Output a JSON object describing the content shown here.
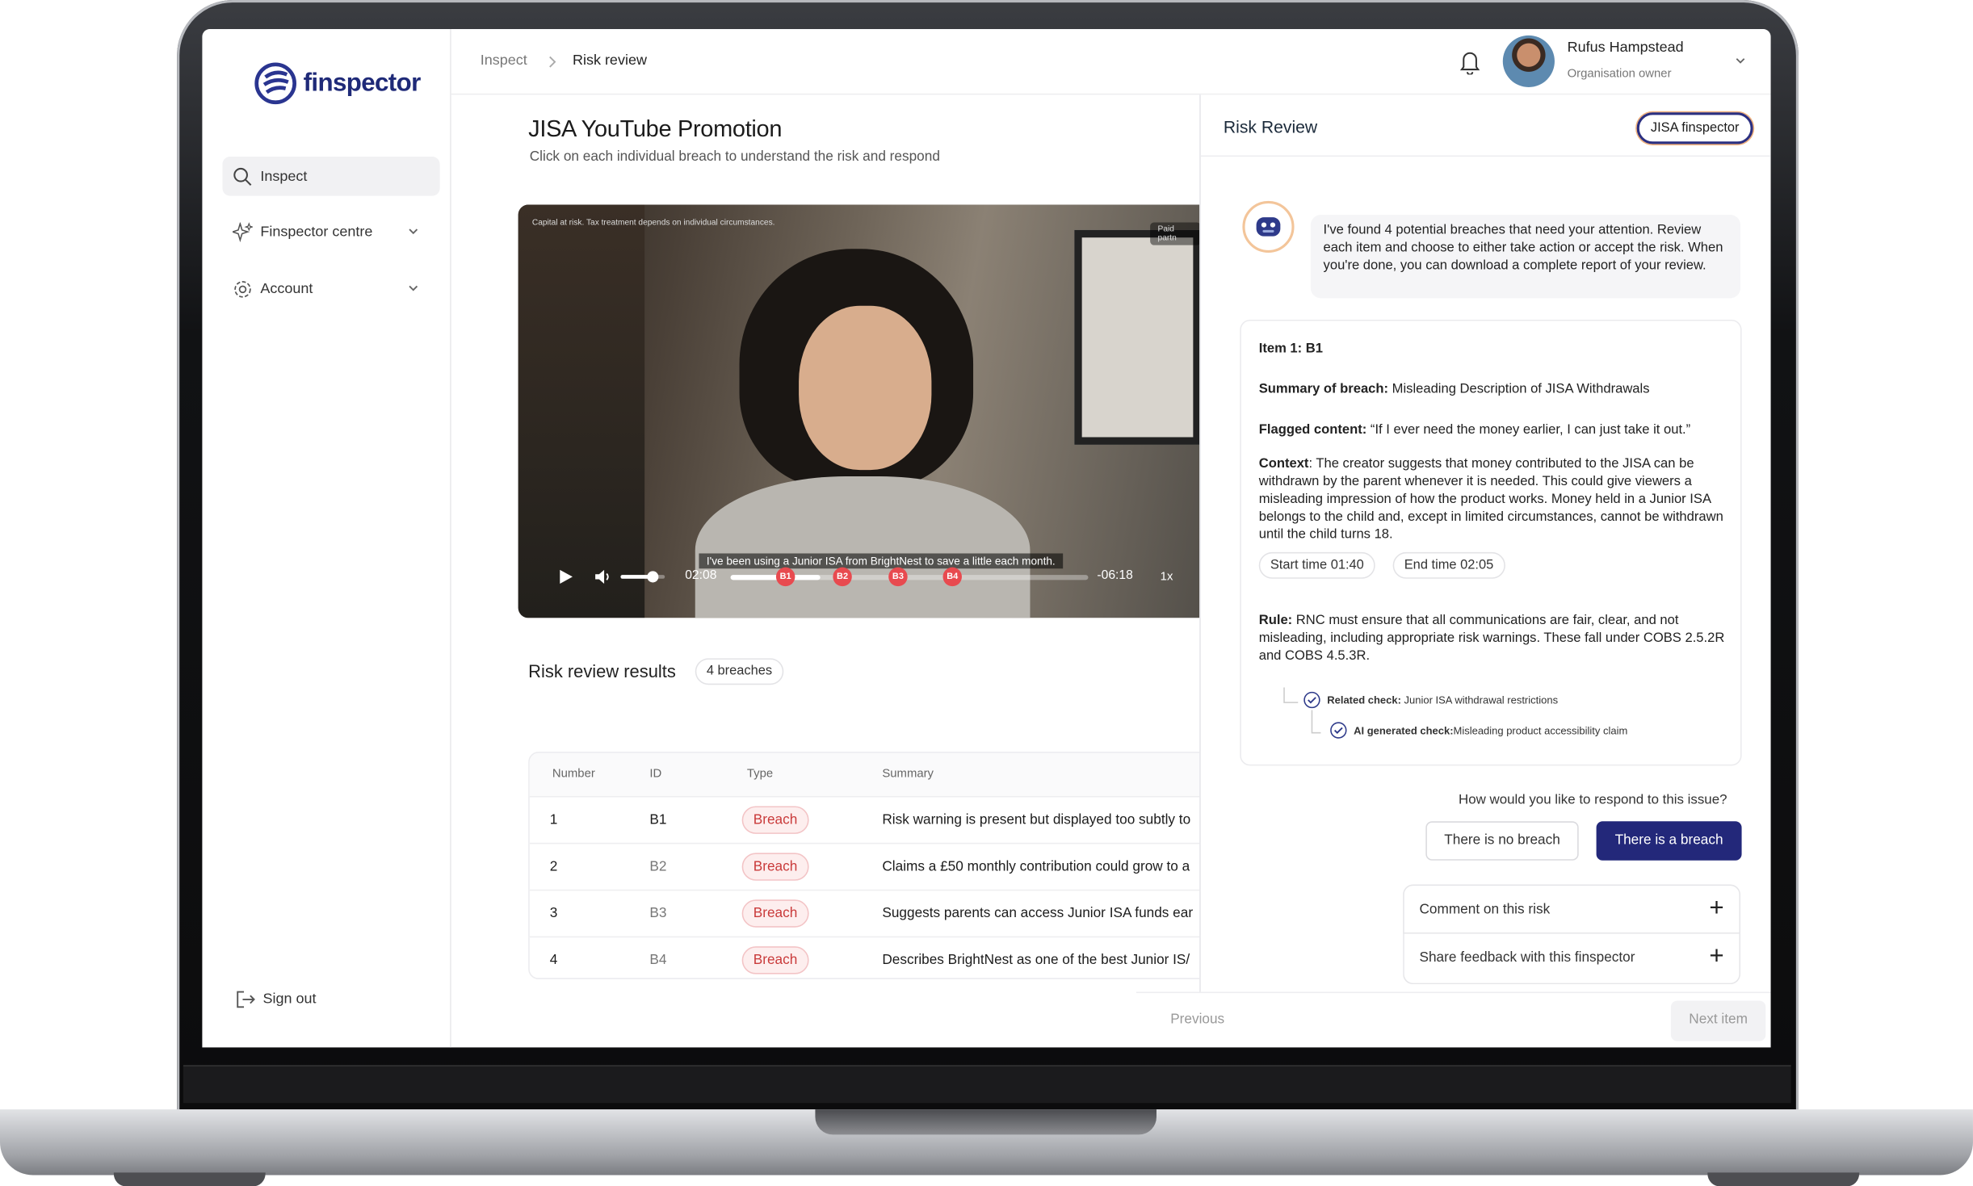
{
  "app": {
    "brand": "finspector"
  },
  "sidebar": {
    "items": [
      {
        "label": "Inspect"
      },
      {
        "label": "Finspector centre"
      },
      {
        "label": "Account"
      }
    ],
    "signout": "Sign out"
  },
  "breadcrumb": {
    "root": "Inspect",
    "current": "Risk review"
  },
  "user": {
    "name": "Rufus Hampstead",
    "role": "Organisation owner"
  },
  "main": {
    "title": "JISA YouTube Promotion",
    "subtitle": "Click on each individual breach to understand the risk and respond"
  },
  "video": {
    "disclaimer": "Capital at risk. Tax treatment depends on individual circumstances.",
    "tag": "Paid partn",
    "caption": "I've been using a Junior ISA from BrightNest to save a little each month.",
    "current_time": "02:08",
    "remaining": "-06:18",
    "speed": "1x",
    "progress": 0.25,
    "volume": 0.7,
    "markers": [
      "B1",
      "B2",
      "B3",
      "B4"
    ]
  },
  "results": {
    "title": "Risk review results",
    "count": "4 breaches",
    "columns": [
      "Number",
      "ID",
      "Type",
      "Summary"
    ],
    "rows": [
      {
        "number": "1",
        "id": "B1",
        "type": "Breach",
        "summary": "Risk warning is present but displayed too subtly to"
      },
      {
        "number": "2",
        "id": "B2",
        "type": "Breach",
        "summary": "Claims a £50 monthly contribution could grow to a"
      },
      {
        "number": "3",
        "id": "B3",
        "type": "Breach",
        "summary": "Suggests parents can access Junior ISA funds ear"
      },
      {
        "number": "4",
        "id": "B4",
        "type": "Breach",
        "summary": "Describes BrightNest as one of the best Junior IS/"
      }
    ]
  },
  "panel": {
    "title": "Risk Review",
    "tag": "JISA finspector",
    "bot_message": "I've found 4 potential breaches that need your attention. Review each item and choose to either take action or accept the risk. When you're done, you can download a complete report of your review.",
    "item": "Item 1: B1",
    "summary_label": "Summary of breach:",
    "summary": "Misleading Description of JISA Withdrawals",
    "flagged_label": "Flagged content:",
    "flagged": "“If I ever need the money earlier, I can just take it out.”",
    "context_label": "Context",
    "context": ": The creator suggests that money contributed to the JISA can be withdrawn by the parent whenever it is needed. This could give viewers a misleading impression of how the product works. Money held in a Junior ISA belongs to the child and, except in limited circumstances, cannot be withdrawn until the child turns 18.",
    "start": "Start time 01:40",
    "end": "End time 02:05",
    "rule_label": "Rule:",
    "rule": "RNC must ensure that all communications are fair, clear, and not misleading, including appropriate risk warnings. These fall under COBS 2.5.2R and COBS 4.5.3R.",
    "related_label": "Related check:",
    "related": "Junior ISA withdrawal restrictions",
    "ai_label": "AI generated check:",
    "ai": "Misleading product accessibility claim",
    "question": "How would you like to respond to this issue?",
    "no_breach": "There is no breach",
    "breach": "There is a breach",
    "comment": "Comment on this risk",
    "feedback": "Share feedback with this finspector",
    "previous": "Previous",
    "next": "Next item"
  },
  "colors": {
    "brand": "#1f2a78",
    "primary_button": "#23287a",
    "breach": "#c93a3a",
    "marker": "#e84a4f"
  }
}
